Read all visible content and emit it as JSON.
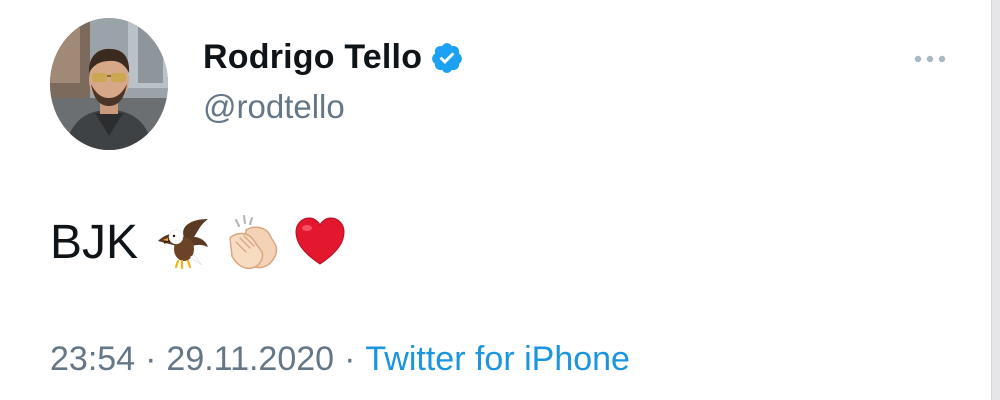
{
  "user": {
    "display_name": "Rodrigo Tello",
    "handle": "@rodtello",
    "verified": true
  },
  "tweet": {
    "text": "BJK",
    "emojis": [
      "eagle-icon",
      "clapping-hands-icon",
      "red-heart-icon"
    ]
  },
  "meta": {
    "time": "23:54",
    "date": "29.11.2020",
    "separator": "·",
    "source": "Twitter for iPhone"
  },
  "colors": {
    "name": "#0f1419",
    "secondary": "#657786",
    "link": "#1b95e0",
    "verified": "#1da1f2"
  },
  "icons": {
    "more": "more-horizontal-icon",
    "verified": "verified-badge-icon"
  }
}
